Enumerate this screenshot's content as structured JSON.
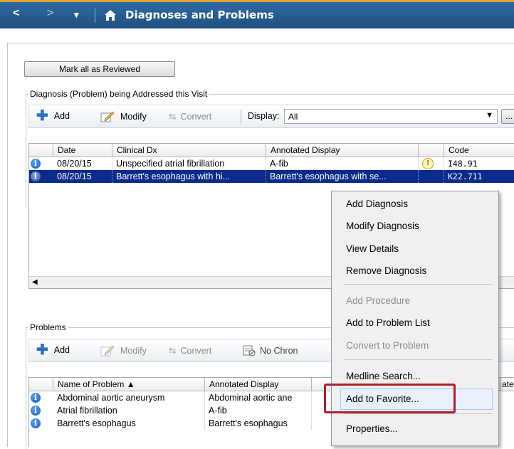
{
  "header": {
    "back": "<",
    "forward": ">",
    "dropdown": "▾",
    "title": "Diagnoses and Problems"
  },
  "mark_reviewed": "Mark all as Reviewed",
  "diagnosis_section": {
    "label": "Diagnosis (Problem) being Addressed this Visit",
    "toolbar": {
      "add": "Add",
      "modify": "Modify",
      "convert": "Convert",
      "display_label": "Display:",
      "display_value": "All",
      "more": "..."
    },
    "columns": [
      "Date",
      "Clinical Dx",
      "Annotated Display",
      "Code"
    ],
    "rows": [
      {
        "date": "08/20/15",
        "clinical_dx": "Unspecified atrial fibrillation",
        "annotated": "A-fib",
        "code": "I48.91"
      },
      {
        "date": "08/20/15",
        "clinical_dx": "Barrett's esophagus with hi...",
        "annotated": "Barrett's esophagus with se...",
        "code": "K22.711"
      }
    ]
  },
  "problems_section": {
    "label": "Problems",
    "toolbar": {
      "add": "Add",
      "modify": "Modify",
      "convert": "Convert",
      "no_chronic": "No Chron"
    },
    "columns": [
      "Name of Problem ▲",
      "Annotated Display",
      "ate"
    ],
    "rows": [
      {
        "name": "Abdominal aortic aneurysm",
        "annotated": "Abdominal aortic ane"
      },
      {
        "name": "Atrial fibrillation",
        "annotated": "A-fib"
      },
      {
        "name": "Barrett's esophagus",
        "annotated": "Barrett's esophagus"
      }
    ]
  },
  "context_menu": {
    "items": [
      {
        "label": "Add Diagnosis",
        "enabled": true
      },
      {
        "label": "Modify Diagnosis",
        "enabled": true
      },
      {
        "label": "View Details",
        "enabled": true
      },
      {
        "label": "Remove Diagnosis",
        "enabled": true
      },
      {
        "label": "Add Procedure",
        "enabled": false
      },
      {
        "label": "Add to Problem List",
        "enabled": true
      },
      {
        "label": "Convert to Problem",
        "enabled": false
      },
      {
        "label": "Medline Search...",
        "enabled": true
      },
      {
        "label": "Add to Favorite...",
        "enabled": true,
        "highlighted": true
      },
      {
        "label": "Properties...",
        "enabled": true
      }
    ]
  },
  "colors": {
    "header_bg": "#2f6aa3",
    "header_accent": "#e8a43a",
    "selection": "#0b2a8a",
    "highlight_box": "#b0202a"
  }
}
